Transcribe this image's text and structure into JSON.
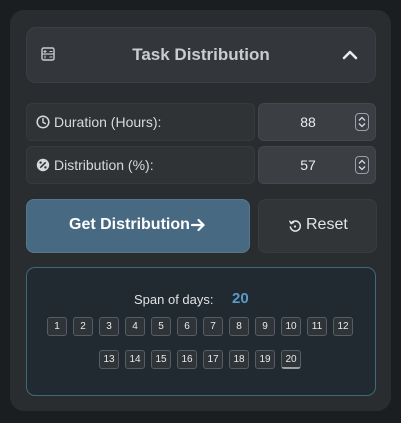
{
  "header": {
    "title": "Task Distribution"
  },
  "fields": {
    "duration": {
      "label": "Duration (Hours):",
      "value": "88"
    },
    "distribution": {
      "label": "Distribution (%):",
      "value": "57"
    }
  },
  "buttons": {
    "get_distribution": "Get Distribution",
    "reset": "Reset"
  },
  "result": {
    "span_label": "Span of days:",
    "span_value": "20",
    "days": [
      "1",
      "2",
      "3",
      "4",
      "5",
      "6",
      "7",
      "8",
      "9",
      "10",
      "11",
      "12",
      "13",
      "14",
      "15",
      "16",
      "17",
      "18",
      "19",
      "20"
    ]
  },
  "colors": {
    "accent": "#476a82",
    "span_value": "#5b9ac6",
    "result_border": "#3e6a78"
  }
}
